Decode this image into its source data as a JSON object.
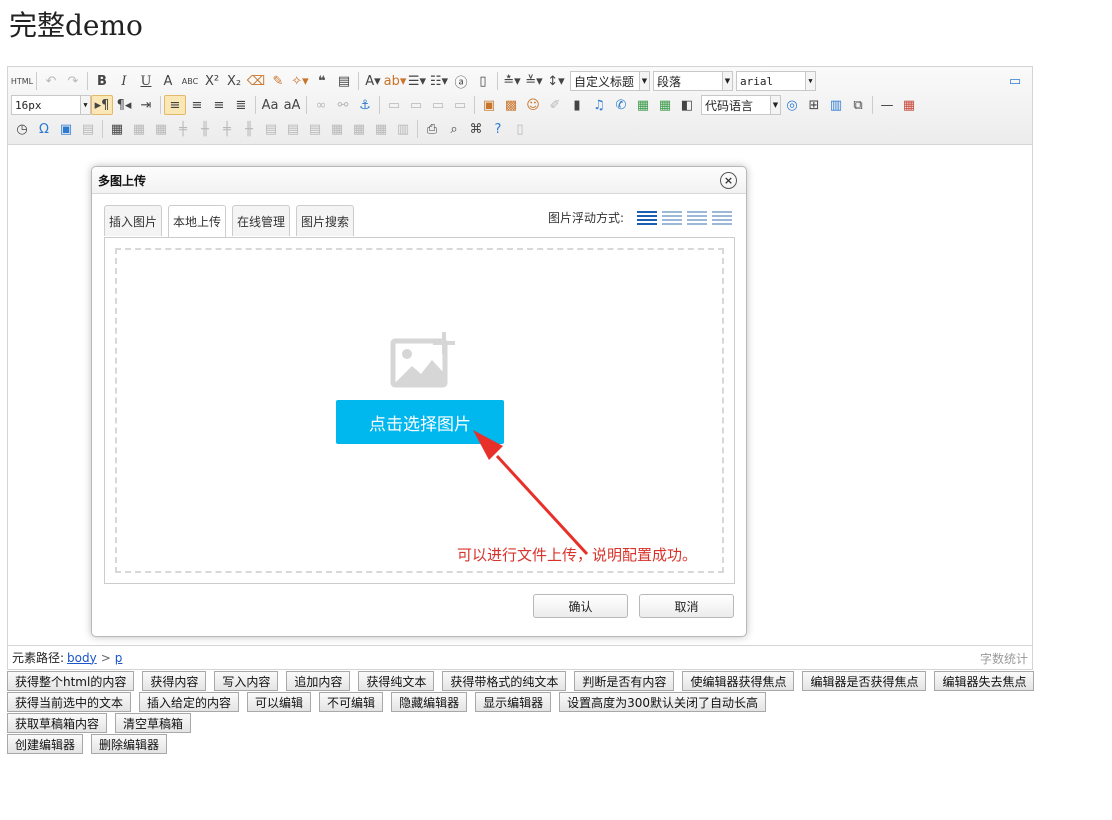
{
  "page": {
    "title": "完整demo"
  },
  "toolbar": {
    "row1_buttons": [
      {
        "name": "source-html-button",
        "glyph": "HTML",
        "cls": "small"
      },
      {
        "sep": true
      },
      {
        "name": "undo-icon",
        "glyph": "↶",
        "cls": "dim"
      },
      {
        "name": "redo-icon",
        "glyph": "↷",
        "cls": "dim"
      },
      {
        "sep": true
      },
      {
        "name": "bold-button",
        "glyph": "B",
        "cls": "bold"
      },
      {
        "name": "italic-button",
        "glyph": "I",
        "cls": "italic"
      },
      {
        "name": "underline-button",
        "glyph": "U",
        "cls": "under"
      },
      {
        "name": "font-border-button",
        "glyph": "A",
        "cls": ""
      },
      {
        "name": "strikethrough-button",
        "glyph": "ABC",
        "cls": "small"
      },
      {
        "name": "superscript-button",
        "glyph": "X²",
        "cls": ""
      },
      {
        "name": "subscript-button",
        "glyph": "X₂",
        "cls": ""
      },
      {
        "name": "eraser-icon",
        "glyph": "⌫",
        "cls": "orange"
      },
      {
        "name": "format-brush-icon",
        "glyph": "✎",
        "cls": "orange"
      },
      {
        "name": "autotypeset-icon",
        "glyph": "✧▾",
        "cls": "orange"
      },
      {
        "name": "blockquote-icon",
        "glyph": "❝",
        "cls": "bold"
      },
      {
        "name": "paste-plain-icon",
        "glyph": "▤",
        "cls": ""
      },
      {
        "sep": true
      },
      {
        "name": "font-color-icon",
        "glyph": "A▾",
        "cls": ""
      },
      {
        "name": "background-color-icon",
        "glyph": "ab▾",
        "cls": "orange"
      },
      {
        "name": "ordered-list-icon",
        "glyph": "☰▾",
        "cls": ""
      },
      {
        "name": "unordered-list-icon",
        "glyph": "☷▾",
        "cls": ""
      },
      {
        "name": "select-all-icon",
        "glyph": "ⓐ",
        "cls": ""
      },
      {
        "name": "clear-doc-icon",
        "glyph": "▯",
        "cls": ""
      },
      {
        "sep": true
      },
      {
        "name": "row-spacing-top-icon",
        "glyph": "≛▾",
        "cls": ""
      },
      {
        "name": "row-spacing-bottom-icon",
        "glyph": "≚▾",
        "cls": ""
      },
      {
        "name": "line-height-icon",
        "glyph": "↕▾",
        "cls": ""
      }
    ],
    "custom_style": "自定义标题",
    "paragraph": "段落",
    "font_family": "arial",
    "font_size": "16px",
    "row2_buttons": [
      {
        "name": "ltr-icon",
        "glyph": "▸¶",
        "cls": "active"
      },
      {
        "name": "rtl-icon",
        "glyph": "¶◂",
        "cls": ""
      },
      {
        "name": "indent-icon",
        "glyph": "⇥",
        "cls": ""
      },
      {
        "sep": true
      },
      {
        "name": "justify-left-icon",
        "glyph": "≡",
        "cls": "active"
      },
      {
        "name": "justify-center-icon",
        "glyph": "≡",
        "cls": ""
      },
      {
        "name": "justify-right-icon",
        "glyph": "≡",
        "cls": ""
      },
      {
        "name": "justify-full-icon",
        "glyph": "≣",
        "cls": ""
      },
      {
        "sep": true
      },
      {
        "name": "touppercase-icon",
        "glyph": "Aa",
        "cls": ""
      },
      {
        "name": "tolowercase-icon",
        "glyph": "aA",
        "cls": ""
      },
      {
        "sep": true
      },
      {
        "name": "link-icon",
        "glyph": "∞",
        "cls": "dim"
      },
      {
        "name": "unlink-icon",
        "glyph": "⚯",
        "cls": "dim"
      },
      {
        "name": "anchor-icon",
        "glyph": "⚓",
        "cls": "blue"
      },
      {
        "sep": true
      },
      {
        "name": "image-none-icon",
        "glyph": "▭",
        "cls": "dim"
      },
      {
        "name": "image-left-icon",
        "glyph": "▭",
        "cls": "dim"
      },
      {
        "name": "image-right-icon",
        "glyph": "▭",
        "cls": "dim"
      },
      {
        "name": "image-center-icon",
        "glyph": "▭",
        "cls": "dim"
      },
      {
        "sep": true
      },
      {
        "name": "simple-upload-icon",
        "glyph": "▣",
        "cls": "orange"
      },
      {
        "name": "insert-image-icon",
        "glyph": "▩",
        "cls": "orange"
      },
      {
        "name": "emotion-icon",
        "glyph": "☺",
        "cls": "orange"
      },
      {
        "name": "scrawl-icon",
        "glyph": "✐",
        "cls": "dim"
      },
      {
        "name": "insert-video-icon",
        "glyph": "▮",
        "cls": ""
      },
      {
        "name": "music-icon",
        "glyph": "♫",
        "cls": "blue"
      },
      {
        "name": "attachment-icon",
        "glyph": "✆",
        "cls": "blue"
      },
      {
        "name": "map-icon",
        "glyph": "▦",
        "cls": "green"
      },
      {
        "name": "gmap-icon",
        "glyph": "▦",
        "cls": "green"
      },
      {
        "name": "insert-frame-icon",
        "glyph": "◧",
        "cls": ""
      }
    ],
    "code_language": "代码语言",
    "row2_tail": [
      {
        "name": "page-break-icon",
        "glyph": "◎",
        "cls": "blue"
      },
      {
        "name": "template-icon",
        "glyph": "⊞",
        "cls": ""
      },
      {
        "name": "background-icon",
        "glyph": "▥",
        "cls": "blue"
      },
      {
        "name": "wordimage-icon",
        "glyph": "⧉",
        "cls": ""
      },
      {
        "sep": true
      },
      {
        "name": "horizontal-rule-icon",
        "glyph": "—",
        "cls": ""
      },
      {
        "name": "date-icon",
        "glyph": "▦",
        "cls": "red"
      }
    ],
    "row3_buttons": [
      {
        "name": "time-icon",
        "glyph": "◷",
        "cls": ""
      },
      {
        "name": "spechars-icon",
        "glyph": "Ω",
        "cls": "blue"
      },
      {
        "name": "snapscreen-icon",
        "glyph": "▣",
        "cls": "blue"
      },
      {
        "name": "webapp-icon",
        "glyph": "▤",
        "cls": "dim"
      },
      {
        "sep": true
      },
      {
        "name": "insert-table-icon",
        "glyph": "▦",
        "cls": ""
      },
      {
        "name": "delete-table-icon",
        "glyph": "▦",
        "cls": "dim"
      },
      {
        "name": "insert-caption-icon",
        "glyph": "▦",
        "cls": "dim"
      },
      {
        "name": "insert-row-icon",
        "glyph": "╪",
        "cls": "dim"
      },
      {
        "name": "insert-col-icon",
        "glyph": "╫",
        "cls": "dim"
      },
      {
        "name": "delete-row-icon",
        "glyph": "╪",
        "cls": "dim"
      },
      {
        "name": "delete-col-icon",
        "glyph": "╫",
        "cls": "dim"
      },
      {
        "name": "merge-cells-icon",
        "glyph": "▤",
        "cls": "dim"
      },
      {
        "name": "merge-right-icon",
        "glyph": "▤",
        "cls": "dim"
      },
      {
        "name": "merge-down-icon",
        "glyph": "▤",
        "cls": "dim"
      },
      {
        "name": "split-cells-icon",
        "glyph": "▦",
        "cls": "dim"
      },
      {
        "name": "split-rows-icon",
        "glyph": "▦",
        "cls": "dim"
      },
      {
        "name": "split-cols-icon",
        "glyph": "▦",
        "cls": "dim"
      },
      {
        "name": "chart-icon",
        "glyph": "▥",
        "cls": "dim"
      },
      {
        "sep": true
      },
      {
        "name": "print-icon",
        "glyph": "⎙",
        "cls": ""
      },
      {
        "name": "preview-icon",
        "glyph": "⌕",
        "cls": ""
      },
      {
        "name": "search-replace-icon",
        "glyph": "⌘",
        "cls": ""
      },
      {
        "name": "help-icon",
        "glyph": "?",
        "cls": "blue"
      },
      {
        "name": "draft-icon",
        "glyph": "▯",
        "cls": "dim"
      }
    ],
    "fullscreen_icon": "▭"
  },
  "dialog": {
    "title": "多图上传",
    "close_glyph": "×",
    "tabs": [
      "插入图片",
      "本地上传",
      "在线管理",
      "图片搜索"
    ],
    "active_tab": 1,
    "float_label": "图片浮动方式:",
    "choose_button": "点击选择图片",
    "annotation": "可以进行文件上传，说明配置成功。",
    "ok_label": "确认",
    "cancel_label": "取消",
    "annotation_color": "#d9322a",
    "button_color": "#00b7ee"
  },
  "status": {
    "path_label": "元素路径:",
    "path": [
      "body",
      "p"
    ],
    "path_sep": ">",
    "word_count": "字数统计"
  },
  "demo_buttons": [
    [
      "获得整个html的内容",
      "获得内容",
      "写入内容",
      "追加内容",
      "获得纯文本",
      "获得带格式的纯文本",
      "判断是否有内容",
      "使编辑器获得焦点",
      "编辑器是否获得焦点",
      "编辑器失去焦点"
    ],
    [
      "获得当前选中的文本",
      "插入给定的内容",
      "可以编辑",
      "不可编辑",
      "隐藏编辑器",
      "显示编辑器",
      "设置高度为300默认关闭了自动长高"
    ],
    [
      "获取草稿箱内容",
      "清空草稿箱"
    ],
    [
      "创建编辑器",
      "删除编辑器"
    ]
  ]
}
